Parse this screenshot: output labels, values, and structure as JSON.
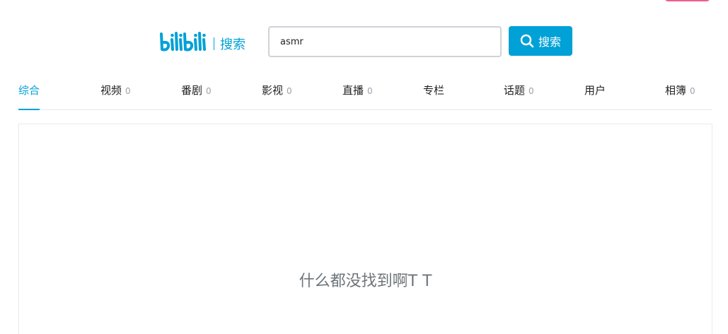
{
  "header": {
    "logo_text": "bilibili",
    "logo_suffix": "搜索"
  },
  "search": {
    "value": "asmr",
    "button_label": "搜索"
  },
  "tabs": [
    {
      "label": "综合",
      "count": "",
      "active": true
    },
    {
      "label": "视频",
      "count": "0"
    },
    {
      "label": "番剧",
      "count": "0"
    },
    {
      "label": "影视",
      "count": "0"
    },
    {
      "label": "直播",
      "count": "0"
    },
    {
      "label": "专栏",
      "count": ""
    },
    {
      "label": "话题",
      "count": "0"
    },
    {
      "label": "用户",
      "count": ""
    },
    {
      "label": "相簿",
      "count": "0"
    }
  ],
  "results": {
    "empty_message": "什么都没找到啊T T"
  },
  "colors": {
    "brand": "#00a1d6",
    "pink_accent": "#f25d8e",
    "border": "#e5e9ef",
    "muted_text": "#6d757a"
  },
  "icons": {
    "search_button_icon": "search-icon",
    "logo": "bilibili-logo"
  }
}
